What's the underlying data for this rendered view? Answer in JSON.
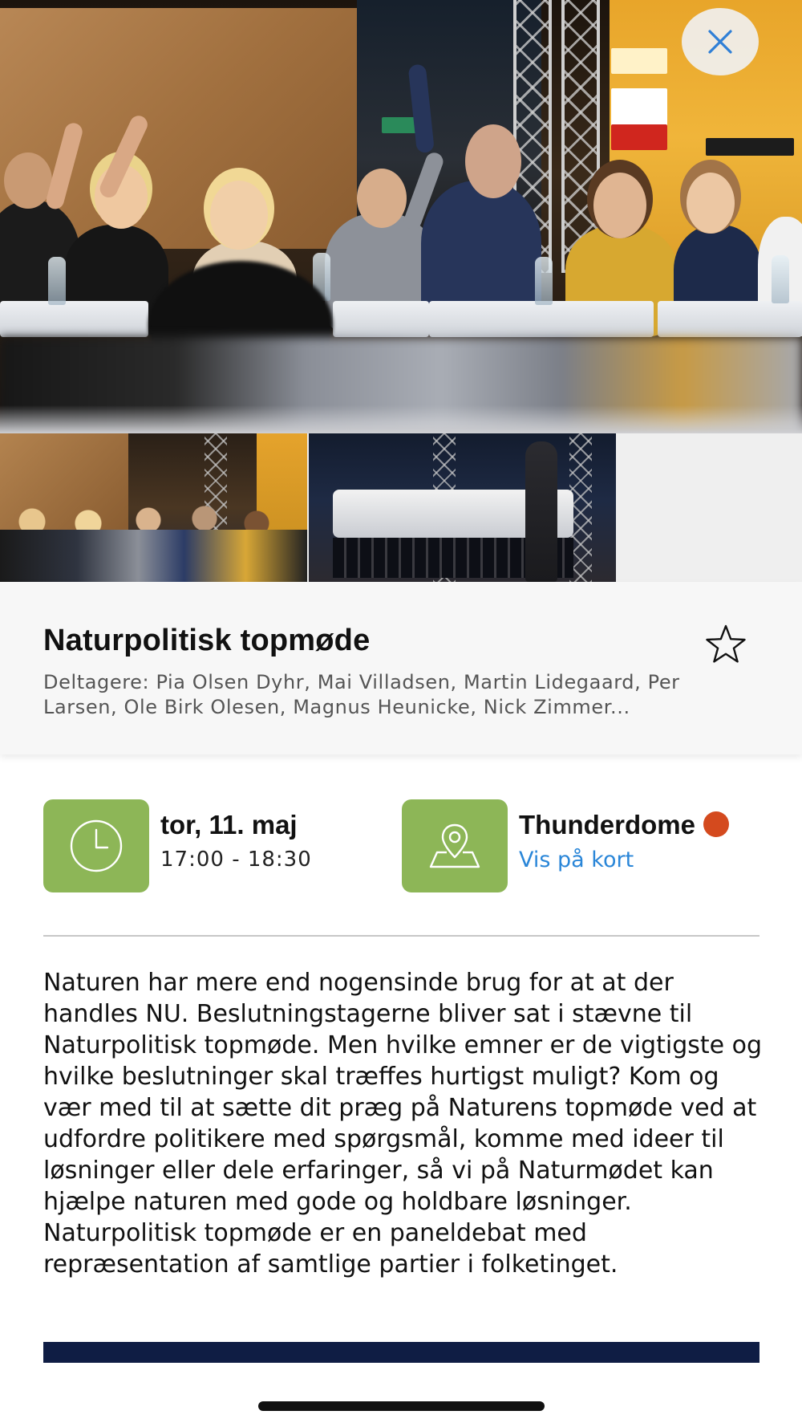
{
  "event": {
    "title": "Naturpolitisk topmøde",
    "participants": "Deltagere: Pia Olsen Dyhr, Mai Villadsen, Martin Lidegaard, Per Larsen, Ole Birk Olesen, Magnus Heunicke, Nick Zimmer...",
    "date": "tor, 11. maj",
    "time": "17:00 - 18:30",
    "location": "Thunderdome",
    "map_link": "Vis på kort",
    "description": "Naturen har mere end nogensinde brug for at at der handles NU. Beslutningstagerne bliver sat i stævne til Naturpolitisk topmøde. Men hvilke emner er de vigtigste og hvilke beslutninger skal træffes hurtigst muligt? Kom og vær med til at sætte dit præg på Naturens topmøde ved at udfordre politikere med spørgsmål, komme med ideer til løsninger eller dele erfaringer, så vi på Naturmødet kan hjælpe naturen med gode og holdbare løsninger. Naturpolitisk topmøde er en paneldebat med repræsentation af samtlige partier i folketinget."
  },
  "icons": {
    "close": "close-icon",
    "favorite": "star-outline-icon",
    "time": "clock-icon",
    "location": "map-pin-icon"
  },
  "colors": {
    "accent_green": "#8db657",
    "link_blue": "#2a86d8",
    "close_icon": "#2f7fd6",
    "status_dot": "#d44a1e",
    "footer_bar": "#0f1d44"
  }
}
